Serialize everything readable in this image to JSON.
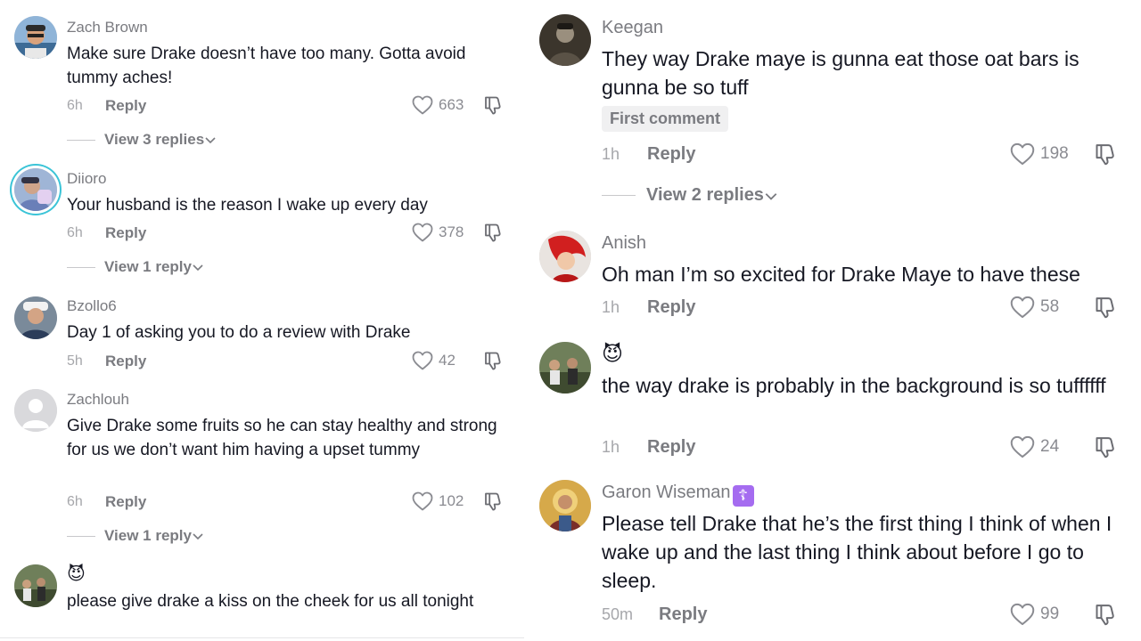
{
  "left_comments": [
    {
      "username": "Zach Brown",
      "text": "Make sure Drake doesn’t have too many. Gotta avoid tummy aches!",
      "time": "6h",
      "reply_label": "Reply",
      "likes": "663",
      "view_replies": "View 3 replies"
    },
    {
      "username": "Diioro",
      "text": "Your husband is the reason I wake up every day",
      "time": "6h",
      "reply_label": "Reply",
      "likes": "378",
      "view_replies": "View 1 reply"
    },
    {
      "username": "Bzollo6",
      "text": "Day 1 of asking you to do a review with Drake",
      "time": "5h",
      "reply_label": "Reply",
      "likes": "42"
    },
    {
      "username": "Zachlouh",
      "text": "Give Drake some fruits so he can stay healthy and strong for us we don’t want him having a upset tummy",
      "time": "6h",
      "reply_label": "Reply",
      "likes": "102",
      "view_replies": "View 1 reply"
    },
    {
      "username": "😈",
      "text": "please give drake a kiss on the cheek for us all tonight"
    }
  ],
  "right_comments": [
    {
      "username": "Keegan",
      "text": "They way Drake maye is gunna eat those oat bars is gunna be so tuff",
      "badge": "First comment",
      "time": "1h",
      "reply_label": "Reply",
      "likes": "198",
      "view_replies": "View 2 replies"
    },
    {
      "username": "Anish",
      "text": "Oh man I’m so excited for Drake Maye to have these",
      "time": "1h",
      "reply_label": "Reply",
      "likes": "58"
    },
    {
      "username": "😈",
      "text": "the way drake is probably in the background is so tuffffff",
      "time": "1h",
      "reply_label": "Reply",
      "likes": "24"
    },
    {
      "username": "Garon Wiseman",
      "username_badge": "☦",
      "text": "Please tell Drake that he’s the first thing I think of when I wake up and the last thing I think about before I go to sleep.",
      "time": "50m",
      "reply_label": "Reply",
      "likes": "99"
    }
  ],
  "colors": {
    "username_gray": "#7a7b80",
    "meta_gray": "#a6a7ab",
    "text": "#161823",
    "story_ring": "#3bc4d7",
    "purple_badge": "#a56cf0"
  },
  "icons": {
    "like": "heart-outline-icon",
    "dislike": "thumbs-down-outline-icon",
    "expand": "chevron-down-icon"
  }
}
